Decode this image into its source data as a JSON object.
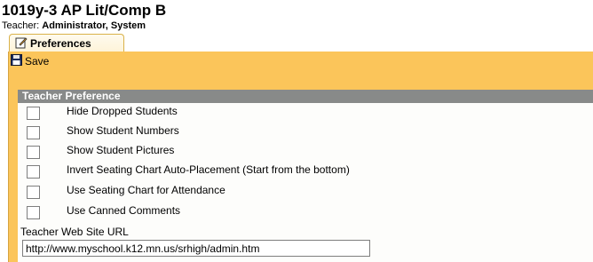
{
  "page": {
    "title": "1019y-3 AP Lit/Comp B",
    "teacher_label": "Teacher:",
    "teacher_name": "Administrator, System"
  },
  "tabs": [
    {
      "label": "Preferences",
      "icon": "edit-icon",
      "active": true
    }
  ],
  "toolbar": {
    "save_label": "Save",
    "save_icon": "floppy-disk-icon"
  },
  "section": {
    "header": "Teacher Preference",
    "options": [
      {
        "label": "Hide Dropped Students",
        "checked": false
      },
      {
        "label": "Show Student Numbers",
        "checked": false
      },
      {
        "label": "Show Student Pictures",
        "checked": false
      },
      {
        "label": "Invert Seating Chart Auto-Placement (Start from the bottom)",
        "checked": false
      },
      {
        "label": "Use Seating Chart for Attendance",
        "checked": false
      },
      {
        "label": "Use Canned Comments",
        "checked": false
      }
    ],
    "url_label": "Teacher Web Site URL",
    "url_value": "http://www.myschool.k12.mn.us/srhigh/admin.htm"
  },
  "colors": {
    "panel": "#fbc55a",
    "section_header": "#888a89",
    "tab_border": "#d9b24a"
  }
}
